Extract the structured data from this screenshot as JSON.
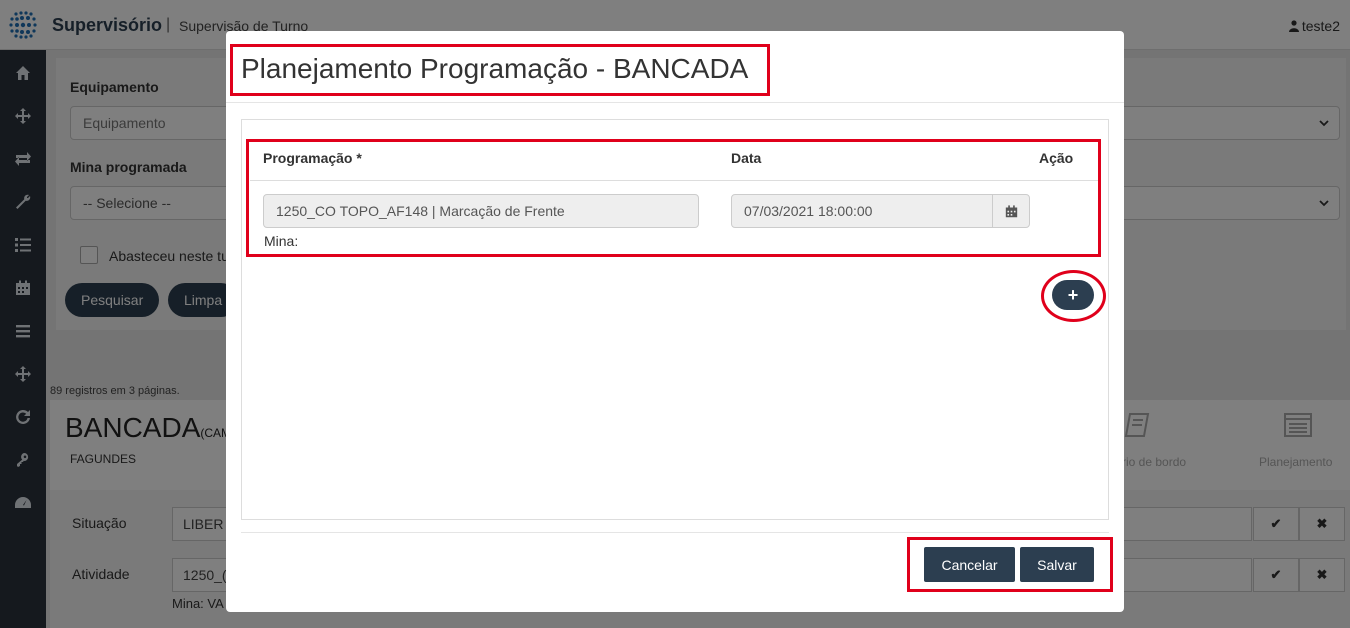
{
  "app": {
    "title": "Supervisório",
    "separator": "|",
    "subtitle": "Supervisão de Turno",
    "user": "teste2"
  },
  "sidebar": {
    "items": [
      "home-icon",
      "move-icon",
      "swap-icon",
      "wrench-icon",
      "list-icon",
      "calendar-icon",
      "menu-icon",
      "move-icon",
      "refresh-icon",
      "key-icon",
      "dashboard-icon"
    ]
  },
  "filters": {
    "equipamento_label": "Equipamento",
    "equipamento_value": "Equipamento",
    "mina_label": "Mina programada",
    "mina_value": "-- Selecione --",
    "abasteceu_label": "Abasteceu neste tu",
    "pesquisar": "Pesquisar",
    "limpar": "Limpa"
  },
  "records": "89 registros em 3 páginas.",
  "card": {
    "title": "BANCADA",
    "title_suffix": "(CAM",
    "subtitle": "FAGUNDES",
    "tool_diario": "rio de bordo",
    "tool_planejamento": "Planejamento"
  },
  "detail": {
    "situacao_label": "Situação",
    "situacao_value": "LIBER",
    "atividade_label": "Atividade",
    "atividade_value": "1250_(",
    "mina_label": "Mina: VA",
    "check": "✔",
    "times": "✖"
  },
  "modal": {
    "title": "Planejamento Programação - BANCADA",
    "columns": {
      "programacao": "Programação *",
      "data": "Data",
      "acao": "Ação"
    },
    "row": {
      "programacao": "1250_CO TOPO_AF148 | Marcação de Frente",
      "data": "07/03/2021 18:00:00",
      "mina": "Mina:"
    },
    "add": "+",
    "cancelar": "Cancelar",
    "salvar": "Salvar"
  },
  "colors": {
    "primary": "#2c3e50",
    "highlight": "#e0001b",
    "sidebar": "#2a323c"
  }
}
